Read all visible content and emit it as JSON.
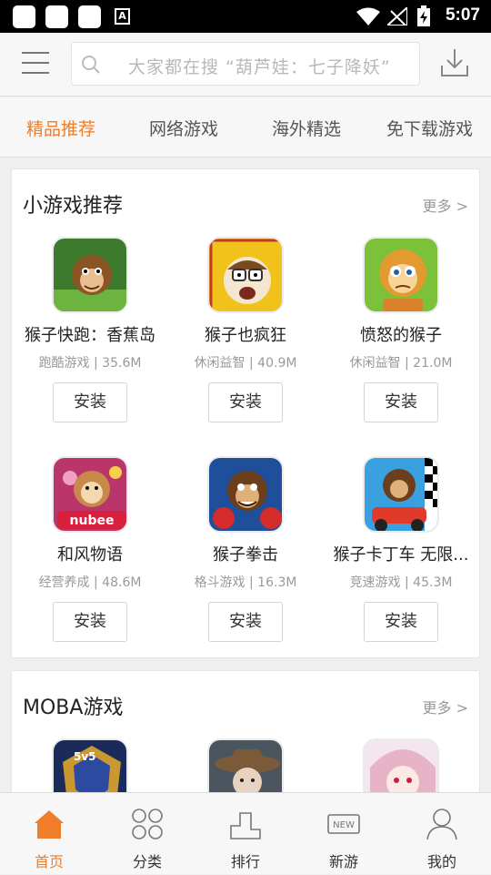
{
  "status_bar": {
    "time": "5:07"
  },
  "header": {
    "search_placeholder": "大家都在搜  “葫芦娃：七子降妖”"
  },
  "tabs": [
    {
      "label": "精品推荐",
      "active": true
    },
    {
      "label": "网络游戏",
      "active": false
    },
    {
      "label": "海外精选",
      "active": false
    },
    {
      "label": "免下载游戏",
      "active": false
    }
  ],
  "sections": [
    {
      "title": "小游戏推荐",
      "more_label": "更多 >",
      "apps": [
        {
          "name": "猴子快跑：香蕉岛",
          "meta": "跑酷游戏 | 35.6M",
          "install_label": "安装",
          "icon": "monkey-run-icon"
        },
        {
          "name": "猴子也疯狂",
          "meta": "休闲益智 | 40.9M",
          "install_label": "安装",
          "icon": "crazy-monkey-icon"
        },
        {
          "name": "愤怒的猴子",
          "meta": "休闲益智 | 21.0M",
          "install_label": "安装",
          "icon": "angry-monkey-icon"
        },
        {
          "name": "和风物语",
          "meta": "经营养成 | 48.6M",
          "install_label": "安装",
          "icon": "nubee-monkey-icon"
        },
        {
          "name": "猴子拳击",
          "meta": "格斗游戏 | 16.3M",
          "install_label": "安装",
          "icon": "boxing-monkey-icon"
        },
        {
          "name": "猴子卡丁车 无限...",
          "meta": "竞速游戏 | 45.3M",
          "install_label": "安装",
          "icon": "kart-monkey-icon"
        }
      ]
    },
    {
      "title": "MOBA游戏",
      "more_label": "更多 >",
      "apps": [
        {
          "icon": "moba-5v5-icon"
        },
        {
          "icon": "moba-girl-hat-icon"
        },
        {
          "icon": "moba-pink-hair-icon"
        }
      ]
    }
  ],
  "bottom_nav": [
    {
      "label": "首页",
      "icon": "home-icon",
      "active": true
    },
    {
      "label": "分类",
      "icon": "category-icon",
      "active": false
    },
    {
      "label": "排行",
      "icon": "ranking-icon",
      "active": false
    },
    {
      "label": "新游",
      "icon": "new-games-icon",
      "active": false,
      "badge": "NEW"
    },
    {
      "label": "我的",
      "icon": "profile-icon",
      "active": false
    }
  ],
  "colors": {
    "accent": "#ef7d2a",
    "status_bar": "#000000"
  }
}
